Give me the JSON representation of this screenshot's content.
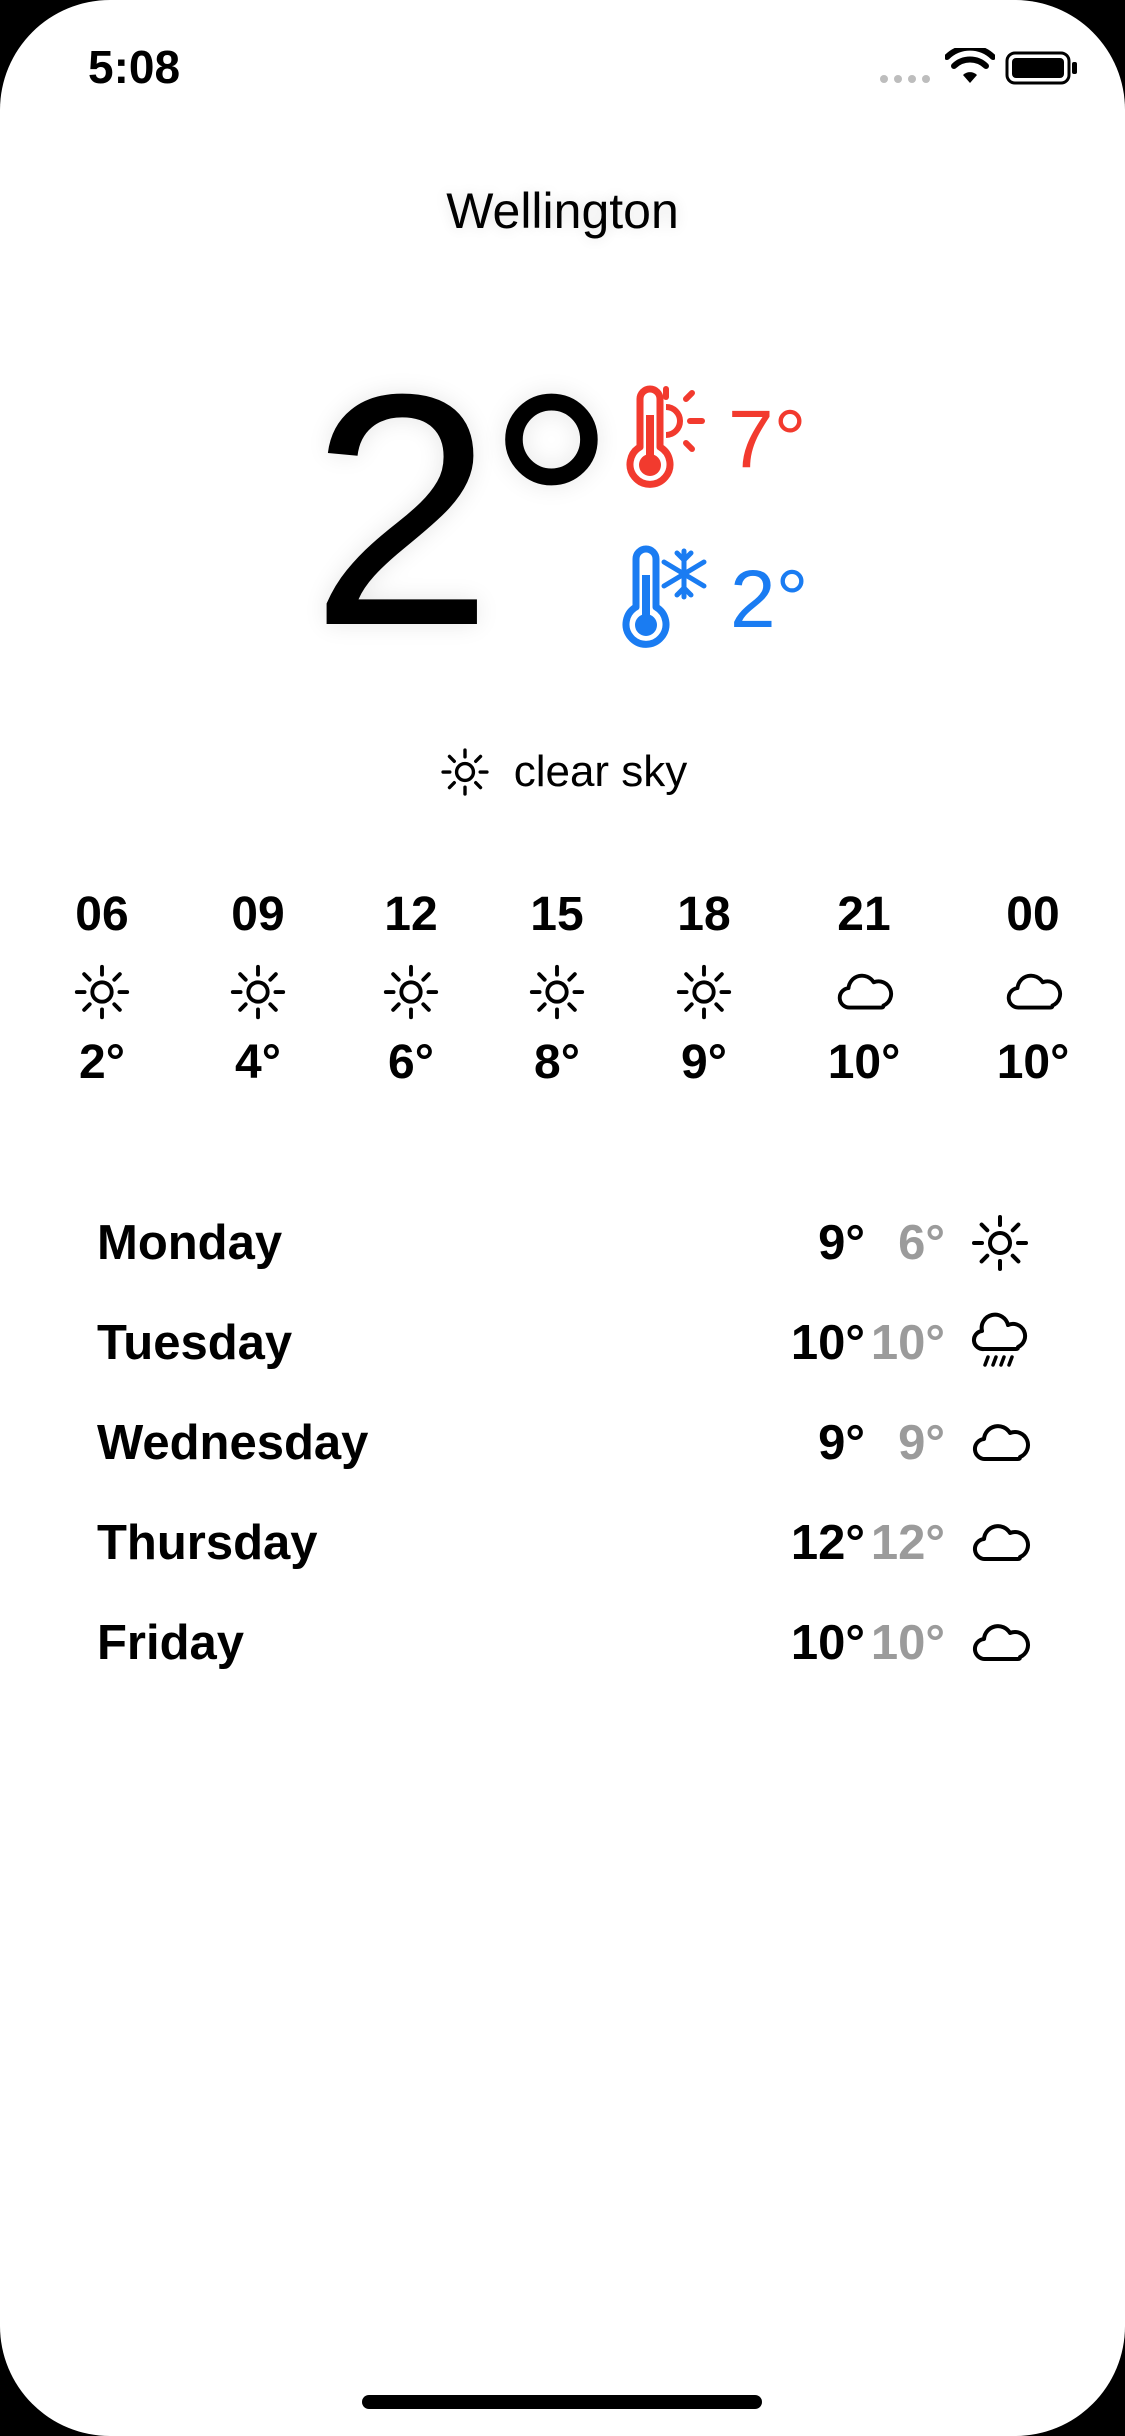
{
  "status_bar": {
    "time": "5:08"
  },
  "location": {
    "city": "Wellington"
  },
  "current": {
    "temperature": "2°",
    "high": "7°",
    "low": "2°",
    "condition_icon": "sun-icon",
    "condition": "clear sky"
  },
  "hourly": [
    {
      "hour": "06",
      "icon": "sun-icon",
      "temp": "2°"
    },
    {
      "hour": "09",
      "icon": "sun-icon",
      "temp": "4°"
    },
    {
      "hour": "12",
      "icon": "sun-icon",
      "temp": "6°"
    },
    {
      "hour": "15",
      "icon": "sun-icon",
      "temp": "8°"
    },
    {
      "hour": "18",
      "icon": "sun-icon",
      "temp": "9°"
    },
    {
      "hour": "21",
      "icon": "cloud-icon",
      "temp": "10°"
    },
    {
      "hour": "00",
      "icon": "cloud-icon",
      "temp": "10°"
    }
  ],
  "daily": [
    {
      "day": "Monday",
      "high": "9°",
      "low": "6°",
      "icon": "sun-icon"
    },
    {
      "day": "Tuesday",
      "high": "10°",
      "low": "10°",
      "icon": "rain-cloud-icon"
    },
    {
      "day": "Wednesday",
      "high": "9°",
      "low": "9°",
      "icon": "cloud-icon"
    },
    {
      "day": "Thursday",
      "high": "12°",
      "low": "12°",
      "icon": "cloud-icon"
    },
    {
      "day": "Friday",
      "high": "10°",
      "low": "10°",
      "icon": "cloud-icon"
    }
  ],
  "colors": {
    "high_temp": "#f23a2e",
    "low_temp": "#1a7cf2",
    "secondary_text": "#9b9b9b"
  }
}
